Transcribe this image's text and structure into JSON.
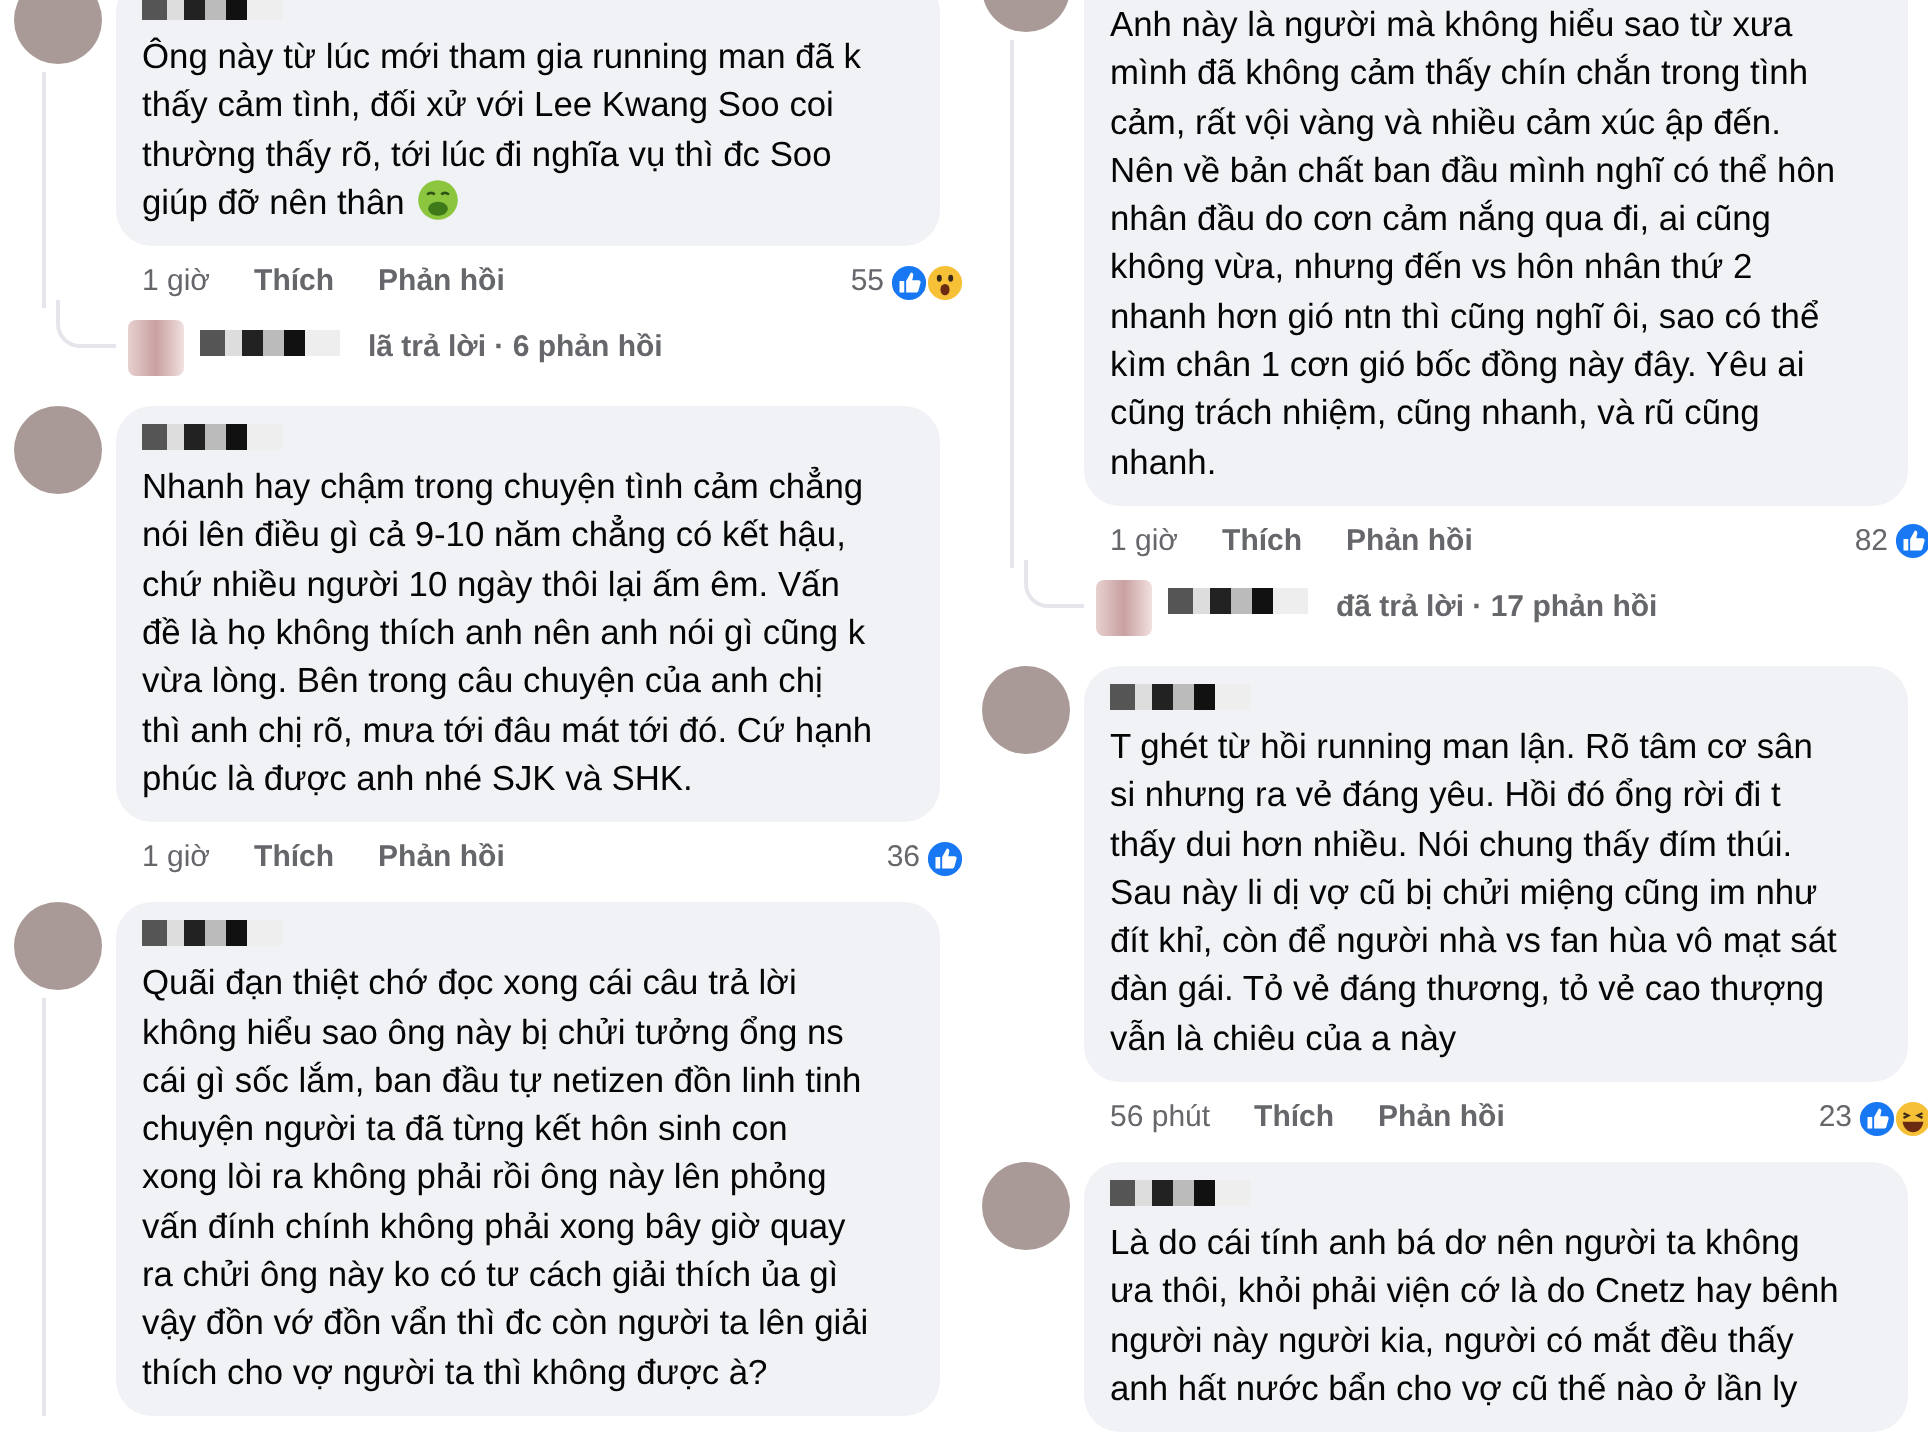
{
  "columns": [
    {
      "items": [
        {
          "kind": "comment",
          "thread_line": true,
          "lines": [
            "Ông này từ lúc mới tham gia running man đã k",
            "thấy cảm tình, đối xử với Lee Kwang Soo coi",
            "thường thấy rõ, tới lúc đi nghĩa vụ thì đc Soo",
            "giúp đỡ nên thân"
          ],
          "has_emoji": true,
          "time": "1 giờ",
          "like": "Thích",
          "reply": "Phản hồi",
          "count": "55",
          "reaction_like": true,
          "reaction_wow": true,
          "reaction_haha": false
        },
        {
          "kind": "replies",
          "text": "lã trả lời · 6 phản hồi"
        },
        {
          "kind": "comment",
          "thread_line": false,
          "lines": [
            "Nhanh hay chậm trong chuyện tình cảm chẳng",
            "nói lên điều gì cả 9-10 năm chẳng có kết hậu,",
            "chứ nhiều người 10 ngày thôi lại ấm êm. Vấn",
            "đề là họ không thích anh nên anh nói gì cũng k",
            "vừa lòng. Bên trong câu chuyện của anh chị",
            "thì anh chị rõ, mưa tới đâu mát tới đó. Cứ hạnh",
            "phúc là được anh nhé SJK và SHK."
          ],
          "has_emoji": false,
          "time": "1 giờ",
          "like": "Thích",
          "reply": "Phản hồi",
          "count": "36",
          "reaction_like": true,
          "reaction_wow": false,
          "reaction_haha": false
        },
        {
          "kind": "comment",
          "thread_line": true,
          "lines": [
            "Quãi đạn thiệt chớ đọc xong cái câu trả lời",
            "không hiểu sao ông này bị chửi tưởng ổng ns",
            "cái gì sốc lắm, ban đầu tự netizen đồn linh tinh",
            "chuyện người ta đã từng kết hôn sinh con",
            "xong lòi ra không phải rồi ông này lên phỏng",
            "vấn đính chính không phải xong bây giờ quay",
            "ra chửi ông này ko có tư cách giải thích ủa gì",
            "vậy đồn vớ đồn vẩn thì đc còn người ta lên giải",
            "thích cho vợ người ta thì không được à?"
          ],
          "has_emoji": false
        }
      ]
    },
    {
      "items": [
        {
          "kind": "comment",
          "thread_line": true,
          "lines": [
            "Anh này là người mà không hiểu sao từ xưa",
            "mình đã không cảm thấy chín chắn trong tình",
            "cảm, rất vội vàng và nhiều cảm xúc ập đến.",
            "Nên về bản chất ban đầu mình nghĩ có thể hôn",
            "nhân đầu do cơn cảm nắng qua đi, ai cũng",
            "không vừa, nhưng đến vs hôn nhân thứ 2",
            "nhanh hơn gió ntn thì cũng nghĩ ôi, sao có thể",
            "kìm chân 1 cơn gió bốc đồng này đây. Yêu ai",
            "cũng trách nhiệm, cũng nhanh, và rũ cũng",
            "nhanh."
          ],
          "has_emoji": false,
          "time": "1 giờ",
          "like": "Thích",
          "reply": "Phản hồi",
          "count": "82",
          "reaction_like": true,
          "reaction_wow": false,
          "reaction_haha": false
        },
        {
          "kind": "replies",
          "text": "đã trả lời · 17 phản hồi"
        },
        {
          "kind": "comment",
          "thread_line": false,
          "lines": [
            "T ghét từ hồi running man lận. Rõ tâm cơ sân",
            "si nhưng ra vẻ đáng yêu. Hồi đó ổng rời đi t",
            "thấy dui hơn nhiều.  Nói chung thấy đím thúi.",
            "Sau này li dị vợ cũ bị chửi miệng cũng im như",
            "đít khỉ, còn để người nhà vs fan hùa vô mạt sát",
            "đàn gái. Tỏ vẻ đáng thương, tỏ vẻ cao thượng",
            "vẫn là chiêu của a này"
          ],
          "has_emoji": false,
          "time": "56 phút",
          "like": "Thích",
          "reply": "Phản hồi",
          "count": "23",
          "reaction_like": true,
          "reaction_wow": false,
          "reaction_haha": true
        },
        {
          "kind": "comment",
          "thread_line": false,
          "lines": [
            "Là do cái tính anh bá dơ nên người ta không",
            "ưa thôi, khỏi phải viện cớ là do Cnetz hay bênh",
            "người này người kia, người có mắt đều thấy",
            "anh hất nước bẩn cho vợ cũ thế nào ở lần ly"
          ],
          "has_emoji": false
        }
      ]
    }
  ]
}
